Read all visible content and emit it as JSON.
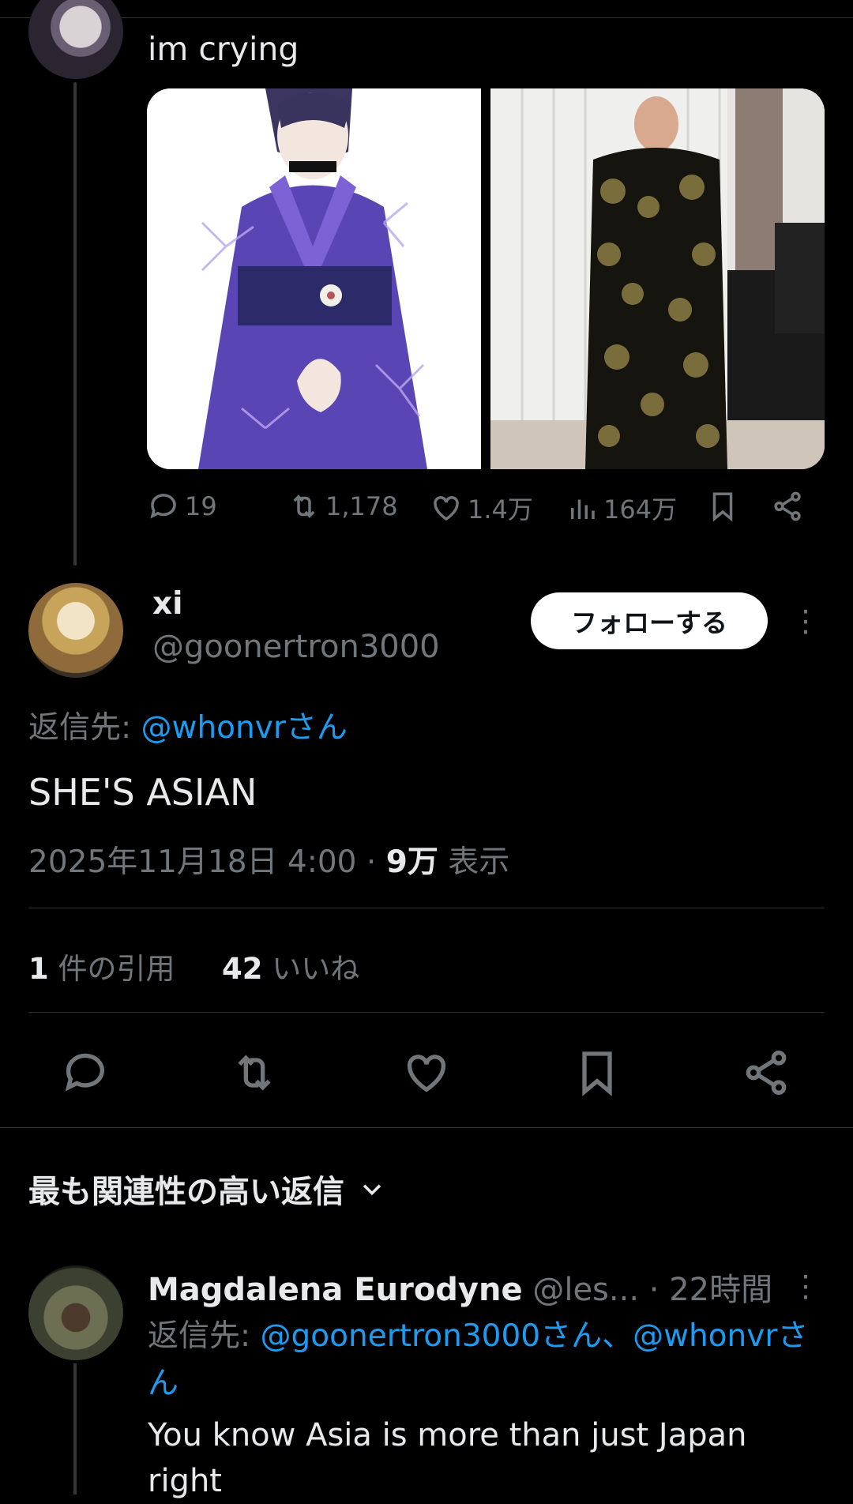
{
  "parent_tweet": {
    "text": "im crying",
    "stats": {
      "replies": "19",
      "retweets": "1,178",
      "likes": "1.4万",
      "views": "164万"
    }
  },
  "main_tweet": {
    "display_name": "xi",
    "handle": "@goonertron3000",
    "follow_label": "フォローする",
    "reply_to_prefix": "返信先: ",
    "reply_to_user": "@whonvrさん",
    "text": "SHE'S ASIAN",
    "timestamp": "2025年11月18日 4:00",
    "separator": " · ",
    "views_count": "9万",
    "views_label": " 表示",
    "quotes_count": "1",
    "quotes_label": " 件の引用",
    "likes_count": "42",
    "likes_label": " いいね"
  },
  "replies_section": {
    "sort_label": "最も関連性の高い返信"
  },
  "reply": {
    "display_name": "Magdalena Eurodyne",
    "handle": "@les...",
    "time": " · 22時間",
    "reply_to_prefix": "返信先: ",
    "reply_to_users": "@goonertron3000さん、@whonvrさん",
    "text": "You know Asia is more than just Japan right"
  },
  "colors": {
    "background": "#000000",
    "text": "#e7e9ea",
    "secondary": "#71767b",
    "link": "#1d9bf0",
    "divider": "#2f3336"
  }
}
